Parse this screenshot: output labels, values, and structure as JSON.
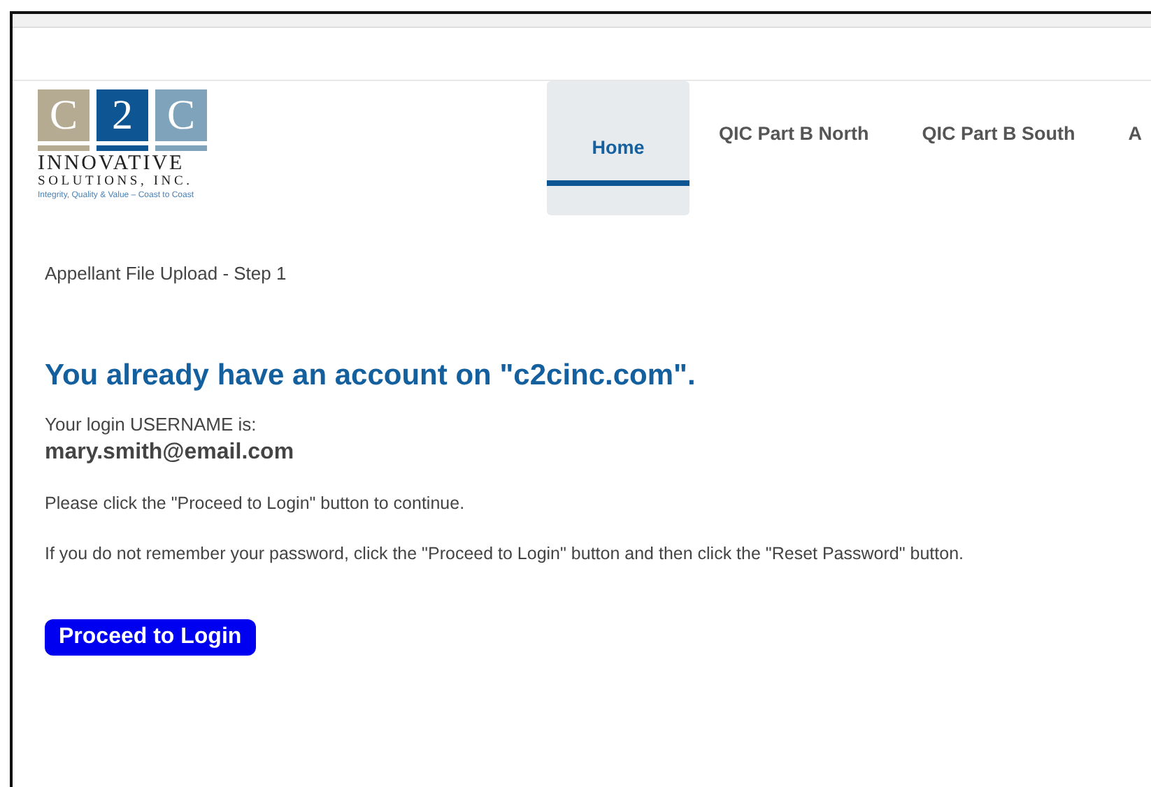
{
  "logo": {
    "letters": [
      "C",
      "2",
      "C"
    ],
    "name": "INNOVATIVE",
    "subtitle": "SOLUTIONS, INC.",
    "tagline": "Integrity, Quality & Value – Coast to Coast"
  },
  "nav": [
    {
      "label": "Home",
      "selected": true
    },
    {
      "label": "QIC Part B North",
      "selected": false
    },
    {
      "label": "QIC Part B South",
      "selected": false
    },
    {
      "label": "A",
      "selected": false
    }
  ],
  "breadcrumb": "Appellant File Upload - Step 1",
  "heading": "You already have an account on \"c2cinc.com\".",
  "username_label": "Your login USERNAME is:",
  "username": "mary.smith@email.com",
  "paragraphs": [
    "Please click the \"Proceed to Login\" button to continue.",
    "If you do not remember your password, click the \"Proceed to Login\" button and then click the \"Reset Password\" button."
  ],
  "button": "Proceed to Login"
}
